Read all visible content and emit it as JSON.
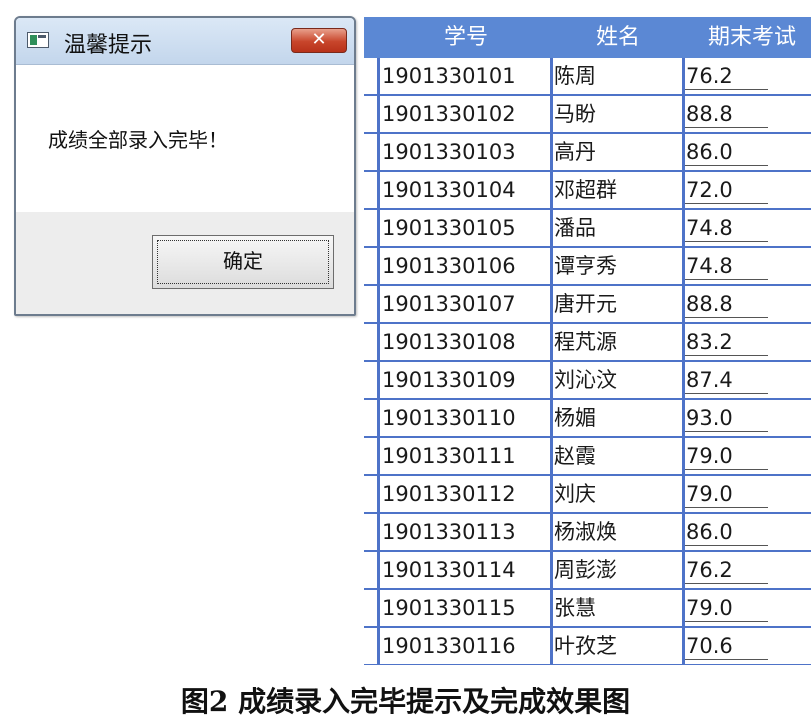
{
  "dialog": {
    "title": "温馨提示",
    "close_label": "✕",
    "message": "成绩全部录入完毕！",
    "ok_label": "确定"
  },
  "table": {
    "headers": [
      "学号",
      "姓名",
      "期末考试"
    ],
    "rows": [
      {
        "id": "1901330101",
        "name": "陈周",
        "score": "76.2"
      },
      {
        "id": "1901330102",
        "name": "马盼",
        "score": "88.8"
      },
      {
        "id": "1901330103",
        "name": "高丹",
        "score": "86.0"
      },
      {
        "id": "1901330104",
        "name": "邓超群",
        "score": "72.0"
      },
      {
        "id": "1901330105",
        "name": "潘品",
        "score": "74.8"
      },
      {
        "id": "1901330106",
        "name": "谭亨秀",
        "score": "74.8"
      },
      {
        "id": "1901330107",
        "name": "唐开元",
        "score": "88.8"
      },
      {
        "id": "1901330108",
        "name": "程芃源",
        "score": "83.2"
      },
      {
        "id": "1901330109",
        "name": "刘沁汶",
        "score": "87.4"
      },
      {
        "id": "1901330110",
        "name": "杨媚",
        "score": "93.0"
      },
      {
        "id": "1901330111",
        "name": "赵霞",
        "score": "79.0"
      },
      {
        "id": "1901330112",
        "name": "刘庆",
        "score": "79.0"
      },
      {
        "id": "1901330113",
        "name": "杨淑焕",
        "score": "86.0"
      },
      {
        "id": "1901330114",
        "name": "周彭澎",
        "score": "76.2"
      },
      {
        "id": "1901330115",
        "name": "张慧",
        "score": "79.0"
      },
      {
        "id": "1901330116",
        "name": "叶孜芝",
        "score": "70.6"
      }
    ]
  },
  "caption": "图2   成绩录入完毕提示及完成效果图",
  "colors": {
    "header_bg": "#5b88d4",
    "grid_line": "#4e73c8",
    "close_button": "#c8452b"
  }
}
